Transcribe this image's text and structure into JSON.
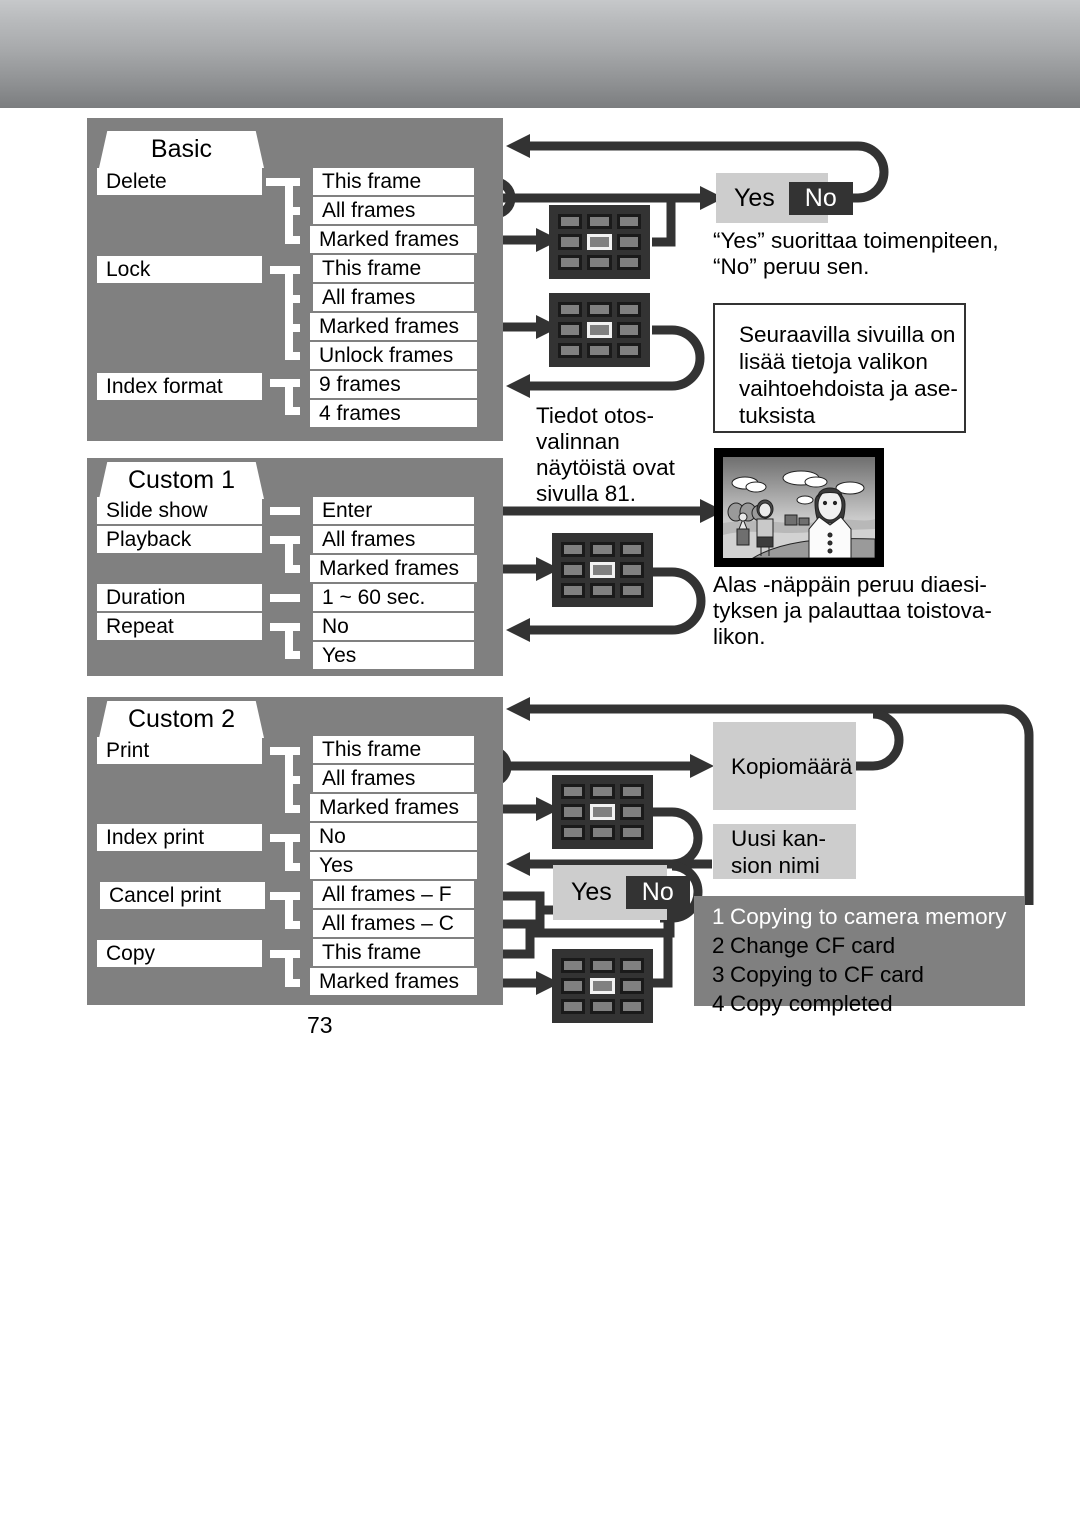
{
  "page": {
    "number": "73"
  },
  "menus": [
    {
      "id": "basic",
      "title": "Basic",
      "items": [
        "Delete",
        "Lock",
        "Index format"
      ],
      "options": [
        "This frame",
        "All frames",
        "Marked frames",
        "This frame",
        "All frames",
        "Marked frames",
        "Unlock frames",
        "9 frames",
        "4 frames"
      ]
    },
    {
      "id": "custom1",
      "title": "Custom 1",
      "items": [
        "Slide show",
        "Playback",
        "Duration",
        "Repeat"
      ],
      "options": [
        "Enter",
        "All frames",
        "Marked frames",
        "1 ~ 60 sec.",
        "No",
        "Yes"
      ]
    },
    {
      "id": "custom2",
      "title": "Custom 2",
      "items": [
        "Print",
        "Index print",
        "Cancel print",
        "Copy"
      ],
      "options": [
        "This frame",
        "All frames",
        "Marked frames",
        "No",
        "Yes",
        "All frames – F",
        "All frames – C",
        "This frame",
        "Marked frames"
      ]
    }
  ],
  "confirm_top": {
    "yes": "Yes",
    "no": "No"
  },
  "confirm_bottom": {
    "yes": "Yes",
    "no": "No"
  },
  "captions": {
    "yes_no_note": "“Yes” suorittaa toimenpiteen,\n“No” peruu sen.",
    "info_box": "Seuraavilla sivuilla on\nlisää tietoja valikon\nvaihtoehdoista ja ase-\ntuksista",
    "frame_select": "Tiedot otos-\nvalinnan\nnäytöistä ovat\nsivulla 81.",
    "slideshow_note": "Alas -näppäin peruu diaesi-\ntyksen ja palauttaa toistova-\nlikon."
  },
  "grey_boxes": {
    "copies": "Kopiomäärä",
    "new_folder": "Uusi kan-\nsion nimi"
  },
  "copy_status": {
    "rows": [
      {
        "n": "1",
        "label": "Copying to camera memory",
        "active": true
      },
      {
        "n": "2",
        "label": "Change CF card",
        "active": false
      },
      {
        "n": "3",
        "label": "Copying to CF card",
        "active": false
      },
      {
        "n": "4",
        "label": "Copy completed",
        "active": false
      }
    ]
  },
  "icons": {
    "index_grid": "index-grid-icon",
    "thumbnail": "photo-thumbnail-icon"
  },
  "colors": {
    "panel_grey": "#808080",
    "cell_white": "#ffffff",
    "line_dark": "#333333",
    "widget_grey": "#cdcdcd",
    "header_top": "#c6c8ca",
    "header_bottom": "#7b7d7f"
  }
}
